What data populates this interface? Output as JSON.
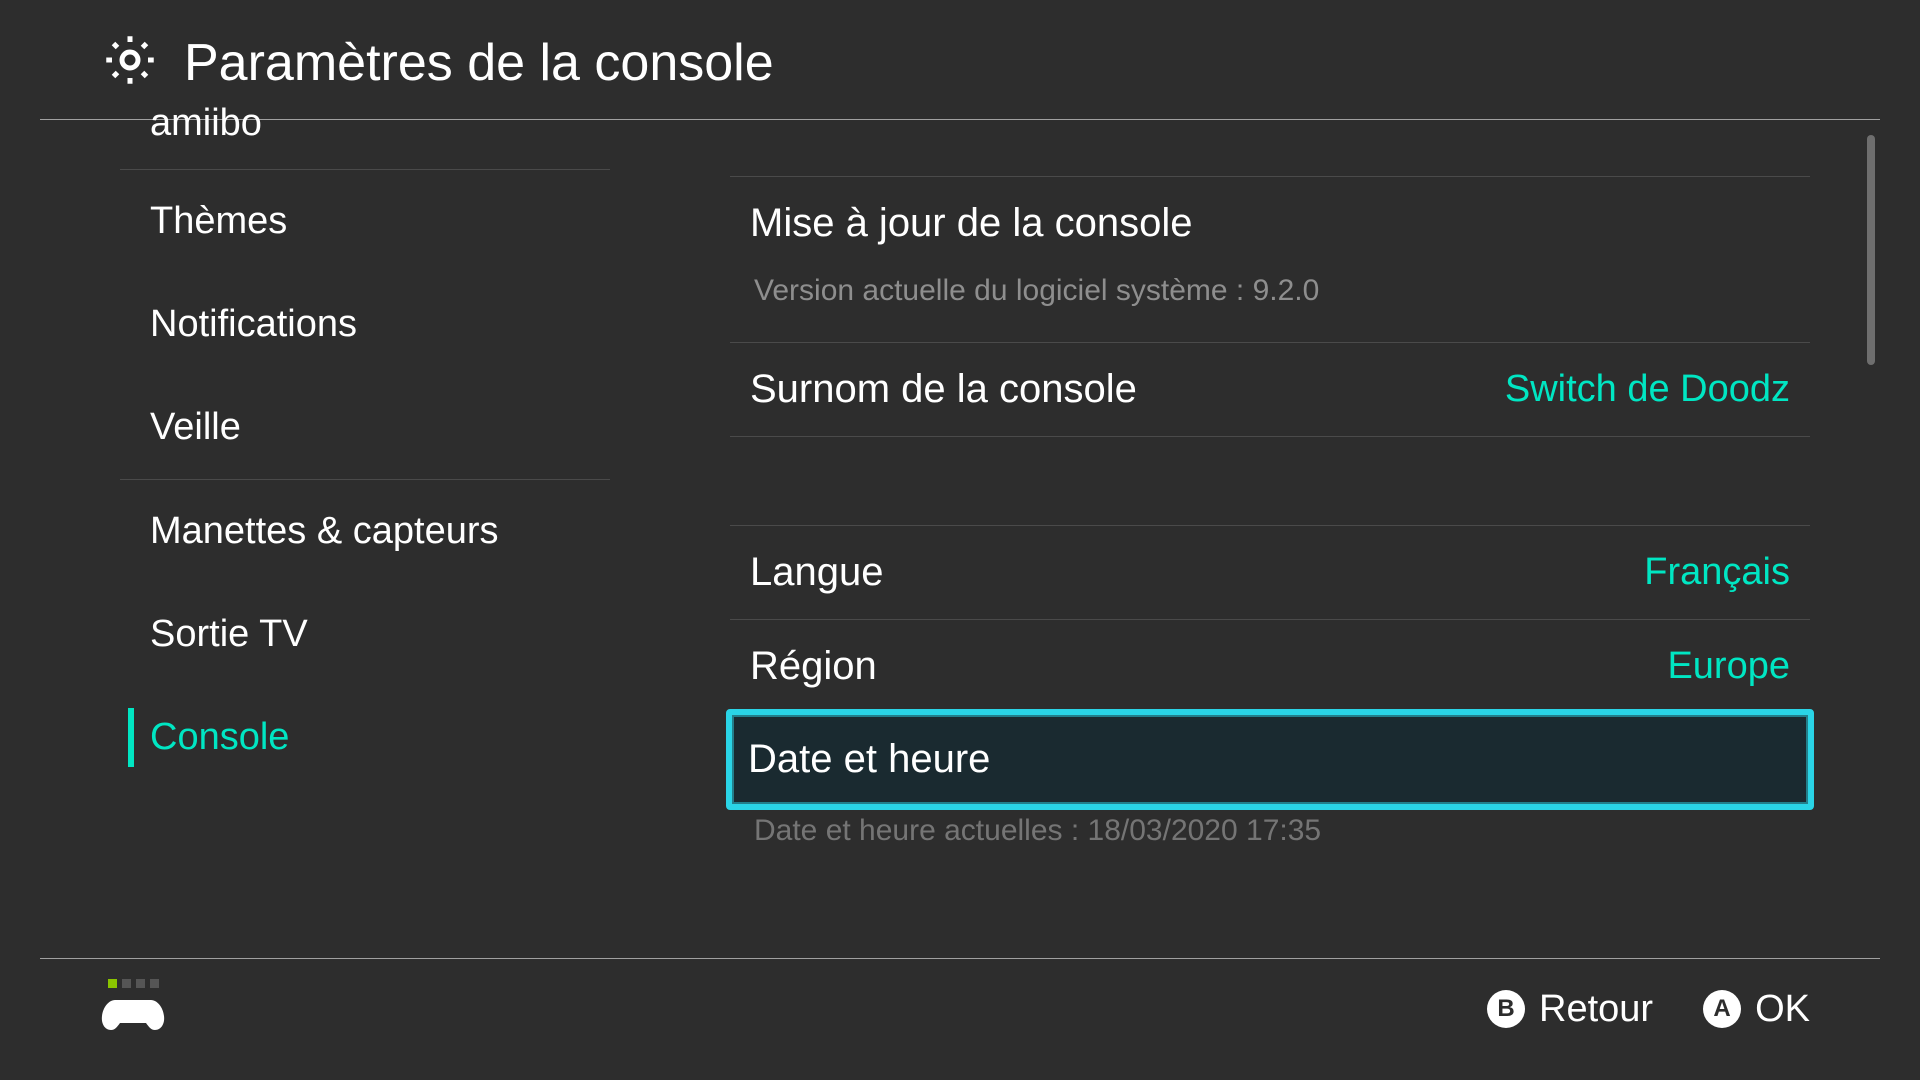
{
  "header": {
    "title": "Paramètres de la console"
  },
  "sidebar": {
    "truncated_top": "amiibo",
    "items": [
      {
        "label": "Thèmes"
      },
      {
        "label": "Notifications"
      },
      {
        "label": "Veille"
      }
    ],
    "items2": [
      {
        "label": "Manettes & capteurs"
      },
      {
        "label": "Sortie TV"
      },
      {
        "label": "Console",
        "selected": true
      }
    ]
  },
  "content": {
    "update": {
      "title": "Mise à jour de la console",
      "subtitle": "Version actuelle du logiciel système : 9.2.0"
    },
    "nickname": {
      "label": "Surnom de la console",
      "value": "Switch de Doodz"
    },
    "language": {
      "label": "Langue",
      "value": "Français"
    },
    "region": {
      "label": "Région",
      "value": "Europe"
    },
    "datetime": {
      "label": "Date et heure",
      "subtitle": "Date et heure actuelles : 18/03/2020 17:35"
    }
  },
  "footer": {
    "back": {
      "key": "B",
      "label": "Retour"
    },
    "ok": {
      "key": "A",
      "label": "OK"
    }
  }
}
